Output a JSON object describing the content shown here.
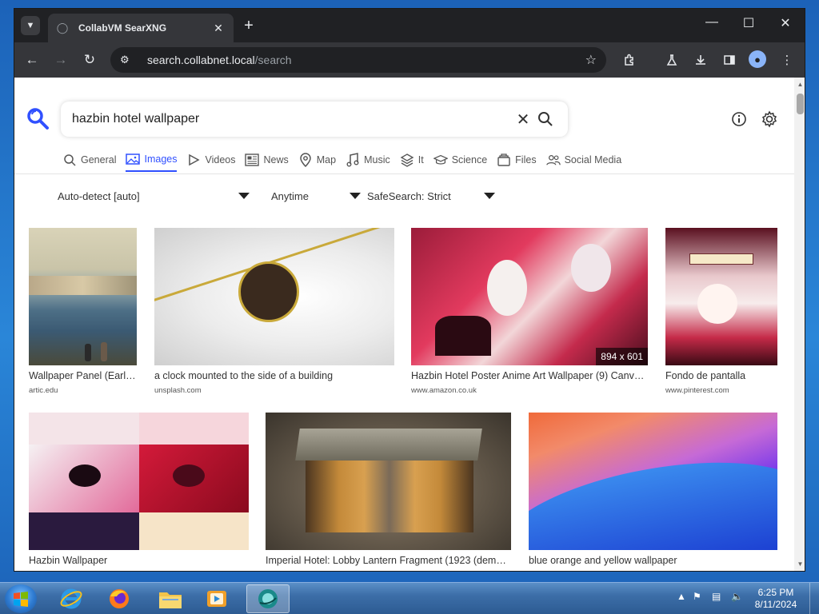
{
  "browser": {
    "tab_title": "CollabVM SearXNG",
    "url_host": "search.collabnet.local",
    "url_path": "/search"
  },
  "search": {
    "query": "hazbin hotel wallpaper"
  },
  "categories": [
    {
      "label": "General",
      "icon": "search-icon"
    },
    {
      "label": "Images",
      "icon": "image-icon"
    },
    {
      "label": "Videos",
      "icon": "play-icon"
    },
    {
      "label": "News",
      "icon": "newspaper-icon"
    },
    {
      "label": "Map",
      "icon": "map-pin-icon"
    },
    {
      "label": "Music",
      "icon": "music-note-icon"
    },
    {
      "label": "It",
      "icon": "layers-icon"
    },
    {
      "label": "Science",
      "icon": "graduation-cap-icon"
    },
    {
      "label": "Files",
      "icon": "files-icon"
    },
    {
      "label": "Social Media",
      "icon": "people-icon"
    }
  ],
  "active_category": "Images",
  "filters": {
    "language": "Auto-detect [auto]",
    "time": "Anytime",
    "safesearch": "SafeSearch: Strict"
  },
  "results": [
    {
      "title": "Wallpaper Panel (Early...",
      "source": "artic.edu",
      "resolution": ""
    },
    {
      "title": "a clock mounted to the side of a building",
      "source": "unsplash.com",
      "resolution": ""
    },
    {
      "title": "Hazbin Hotel Poster Anime Art Wallpaper (9) Canvas...",
      "source": "www.amazon.co.uk",
      "resolution": "894 x 601"
    },
    {
      "title": "Fondo de pantalla",
      "source": "www.pinterest.com",
      "resolution": ""
    },
    {
      "title": "Hazbin Wallpaper",
      "source": "",
      "resolution": ""
    },
    {
      "title": "Imperial Hotel: Lobby Lantern Fragment (1923 (demolished...",
      "source": "",
      "resolution": ""
    },
    {
      "title": "blue orange and yellow wallpaper",
      "source": "",
      "resolution": ""
    }
  ],
  "taskbar": {
    "time": "6:25 PM",
    "date": "8/11/2024"
  },
  "colors": {
    "accent": "#3050ff",
    "browser_dark": "#202124",
    "toolbar": "#35363a"
  }
}
